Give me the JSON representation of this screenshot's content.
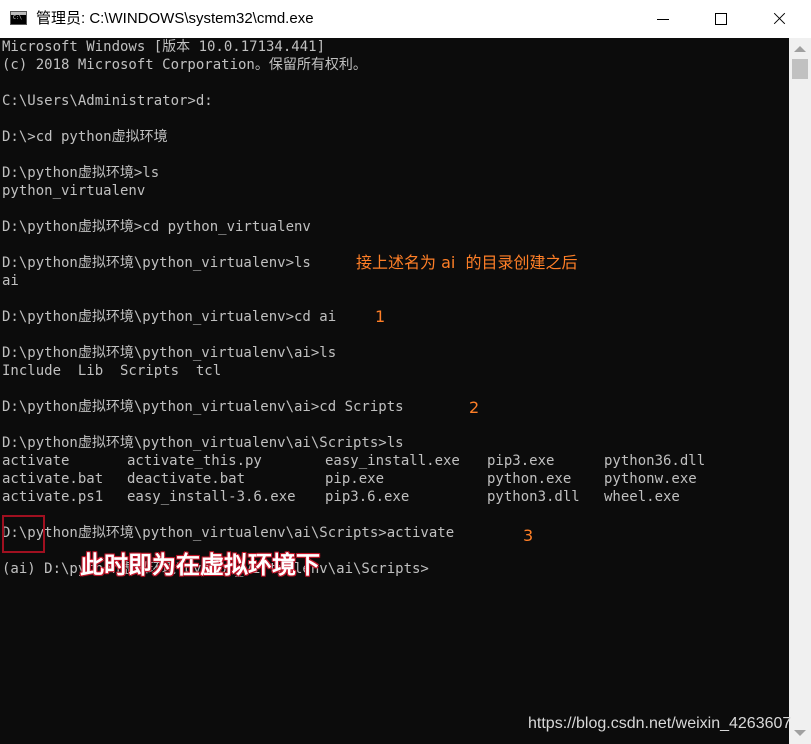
{
  "window": {
    "title": "管理员: C:\\WINDOWS\\system32\\cmd.exe",
    "icon": "cmd-console-icon",
    "controls": [
      "minimize-icon",
      "maximize-icon",
      "close-icon"
    ]
  },
  "console": {
    "background": "#0c0c0c",
    "text_color": "#c0c0c0",
    "lines": [
      "Microsoft Windows [版本 10.0.17134.441]",
      "(c) 2018 Microsoft Corporation。保留所有权利。",
      "C:\\Users\\Administrator>d:",
      "D:\\>cd python虚拟环境",
      "D:\\python虚拟环境>ls",
      "python_virtualenv",
      "D:\\python虚拟环境>cd python_virtualenv",
      "D:\\python虚拟环境\\python_virtualenv>ls",
      "ai",
      "D:\\python虚拟环境\\python_virtualenv>cd ai",
      "D:\\python虚拟环境\\python_virtualenv\\ai>ls",
      "Include  Lib  Scripts  tcl",
      "D:\\python虚拟环境\\python_virtualenv\\ai>cd Scripts",
      "D:\\python虚拟环境\\python_virtualenv\\ai\\Scripts>ls",
      "D:\\python虚拟环境\\python_virtualenv\\ai\\Scripts>activate",
      "(ai) D:\\python虚拟环境\\python_virtualenv\\ai\\Scripts>"
    ],
    "scripts_listing": [
      [
        "activate",
        "activate_this.py",
        "easy_install.exe",
        "pip3.exe",
        "python36.dll"
      ],
      [
        "activate.bat",
        "deactivate.bat",
        "pip.exe",
        "python.exe",
        "pythonw.exe"
      ],
      [
        "activate.ps1",
        "easy_install-3.6.exe",
        "pip3.6.exe",
        "python3.dll",
        "wheel.exe"
      ]
    ]
  },
  "annotations": {
    "color": "#ff7f27",
    "after_ls_note": "接上述名为 ai  的目录创建之后",
    "step1": "1",
    "step2": "2",
    "step3": "3",
    "virtual_env_note": "此时即为在虚拟环境下",
    "note_color": "#ffffff",
    "highlight_color": "#a01020"
  },
  "watermark": "https://blog.csdn.net/weixin_4263607"
}
